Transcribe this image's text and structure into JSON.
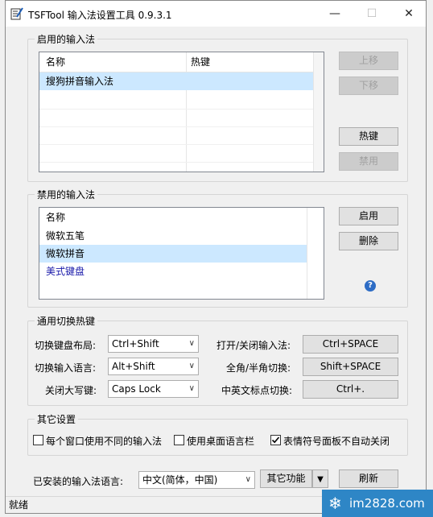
{
  "window": {
    "title": "TSFTool 输入法设置工具 0.9.3.1"
  },
  "enabled_group": {
    "title": "启用的输入法",
    "headers": [
      "名称",
      "热键"
    ],
    "rows": [
      {
        "name": "搜狗拼音输入法",
        "hotkey": ""
      }
    ],
    "buttons": {
      "up": "上移",
      "down": "下移",
      "hotkey": "热键",
      "disable": "禁用"
    }
  },
  "disabled_group": {
    "title": "禁用的输入法",
    "header": "名称",
    "rows": [
      "微软五笔",
      "微软拼音",
      "美式键盘"
    ],
    "buttons": {
      "enable": "启用",
      "delete": "删除"
    },
    "help_icon": "?"
  },
  "hotkey_group": {
    "title": "通用切换热键",
    "switch_layout": {
      "label": "切换键盘布局:",
      "value": "Ctrl+Shift"
    },
    "switch_lang": {
      "label": "切换输入语言:",
      "value": "Alt+Shift"
    },
    "caps": {
      "label": "关闭大写键:",
      "value": "Caps Lock"
    },
    "toggle_ime": {
      "label": "打开/关闭输入法:",
      "value": "Ctrl+SPACE"
    },
    "full_half": {
      "label": "全角/半角切换:",
      "value": "Shift+SPACE"
    },
    "punct": {
      "label": "中英文标点切换:",
      "value": "Ctrl+."
    }
  },
  "other_group": {
    "title": "其它设置",
    "checks": [
      {
        "label": "每个窗口使用不同的输入法",
        "checked": false
      },
      {
        "label": "使用桌面语言栏",
        "checked": false
      },
      {
        "label": "表情符号面板不自动关闭",
        "checked": true
      }
    ]
  },
  "footer": {
    "lang_label": "已安装的输入法语言:",
    "lang_value": "中文(简体，中国)",
    "more_button": "其它功能",
    "refresh_button": "刷新"
  },
  "status": "就绪",
  "watermark": "im2828.com"
}
